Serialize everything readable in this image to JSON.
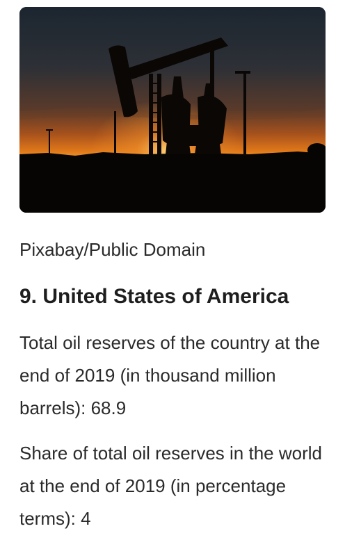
{
  "image": {
    "description_icon": "oil-pump-sunset-photo"
  },
  "caption": {
    "credit": "Pixabay/Public Domain"
  },
  "section": {
    "heading": "9. United States of America",
    "paragraphs": [
      "Total oil reserves of the country at the end of 2019 (in thousand million barrels): 68.9",
      "Share of total oil reserves in the world at the end of 2019 (in percentage terms): 4"
    ]
  }
}
